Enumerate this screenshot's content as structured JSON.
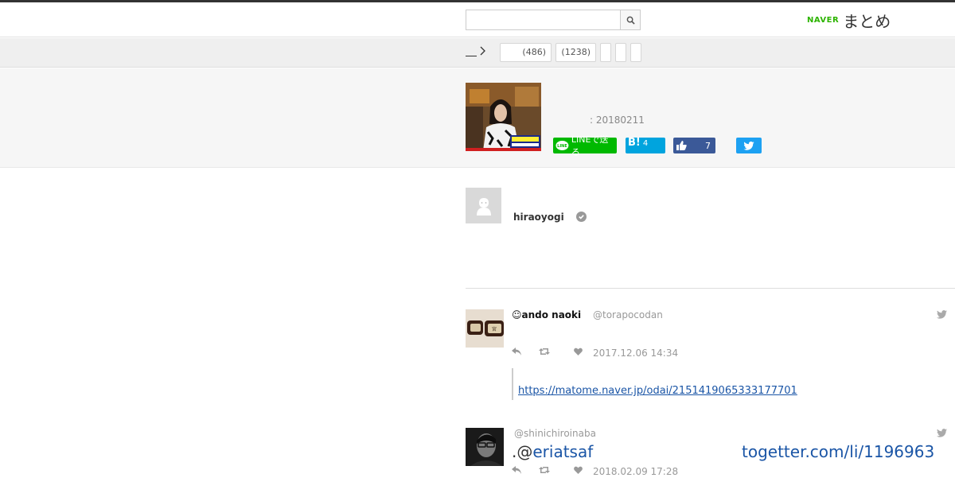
{
  "header": {
    "search_placeholder": "",
    "search_value": "",
    "logo_naver": "NAVER",
    "logo_matome": "まとめ"
  },
  "breadcrumb": {
    "pills": [
      {
        "label": "(486)"
      },
      {
        "label": "(1238)"
      },
      {
        "label": ""
      },
      {
        "label": ""
      },
      {
        "label": ""
      }
    ]
  },
  "matome": {
    "updated": ": 20180211",
    "share": {
      "line_label": "LINEで送る",
      "hatena_label": "B!",
      "hatena_count": "4",
      "facebook_count": "7"
    }
  },
  "author": {
    "name": "hiraoyogi"
  },
  "tweets": [
    {
      "name": "ando naoki",
      "handle": "@torapocodan",
      "time": "2017.12.06 14:34",
      "link": "https://matome.naver.jp/odai/2151419065333177701"
    },
    {
      "name": "",
      "handle": "@shinichiroinaba",
      "body_prefix": ".@",
      "body_mention": "eriatsaf",
      "togetter": "togetter.com/li/1196963",
      "time": "2018.02.09 17:28"
    }
  ],
  "colors": {
    "line": "#00b900",
    "hatena": "#00a4de",
    "facebook": "#3b5998",
    "twitter": "#1da1f2",
    "naver": "#2db400",
    "link": "#1a55a6"
  }
}
